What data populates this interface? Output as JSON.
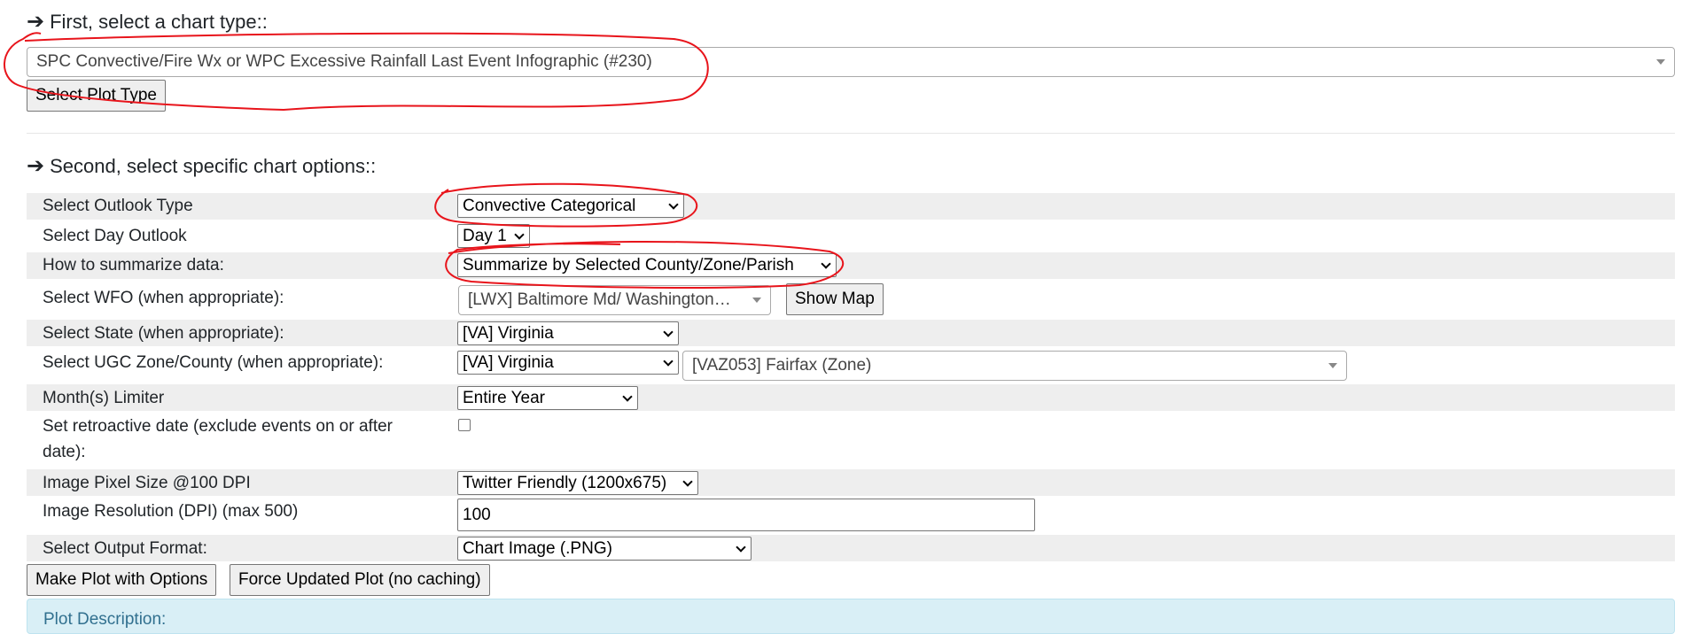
{
  "step1": {
    "heading": "First, select a chart type::",
    "chart_type_value": "SPC Convective/Fire Wx or WPC Excessive Rainfall Last Event Infographic (#230)",
    "select_button": "Select Plot Type"
  },
  "step2": {
    "heading": "Second, select specific chart options::",
    "outlook_type": {
      "label": "Select Outlook Type",
      "value": "Convective Categorical"
    },
    "day_outlook": {
      "label": "Select Day Outlook",
      "value": "Day 1"
    },
    "summarize": {
      "label": "How to summarize data:",
      "value": "Summarize by Selected County/Zone/Parish"
    },
    "wfo": {
      "label": "Select WFO (when appropriate):",
      "value": "[LWX] Baltimore Md/ Washington…",
      "button": "Show Map"
    },
    "state": {
      "label": "Select State (when appropriate):",
      "value": "[VA] Virginia"
    },
    "ugc": {
      "label": "Select UGC Zone/County (when appropriate):",
      "state_value": "[VA] Virginia",
      "zone_value": "[VAZ053] Fairfax (Zone)"
    },
    "months": {
      "label": "Month(s) Limiter",
      "value": "Entire Year"
    },
    "retro": {
      "label_line1": "Set retroactive date (exclude events on or after",
      "label_line2": "date):"
    },
    "pixel_size": {
      "label": "Image Pixel Size @100 DPI",
      "value": "Twitter Friendly (1200x675)"
    },
    "dpi": {
      "label": "Image Resolution (DPI) (max 500)",
      "value": "100"
    },
    "output_format": {
      "label": "Select Output Format:",
      "value": "Chart Image (.PNG)"
    },
    "make_plot_button": "Make Plot with Options",
    "force_button": "Force Updated Plot (no caching)"
  },
  "description": {
    "title": "Plot Description:"
  },
  "colors": {
    "annotation": "#e8141b",
    "row_shade": "#eeeeee",
    "info_bg": "#d9eff6"
  }
}
